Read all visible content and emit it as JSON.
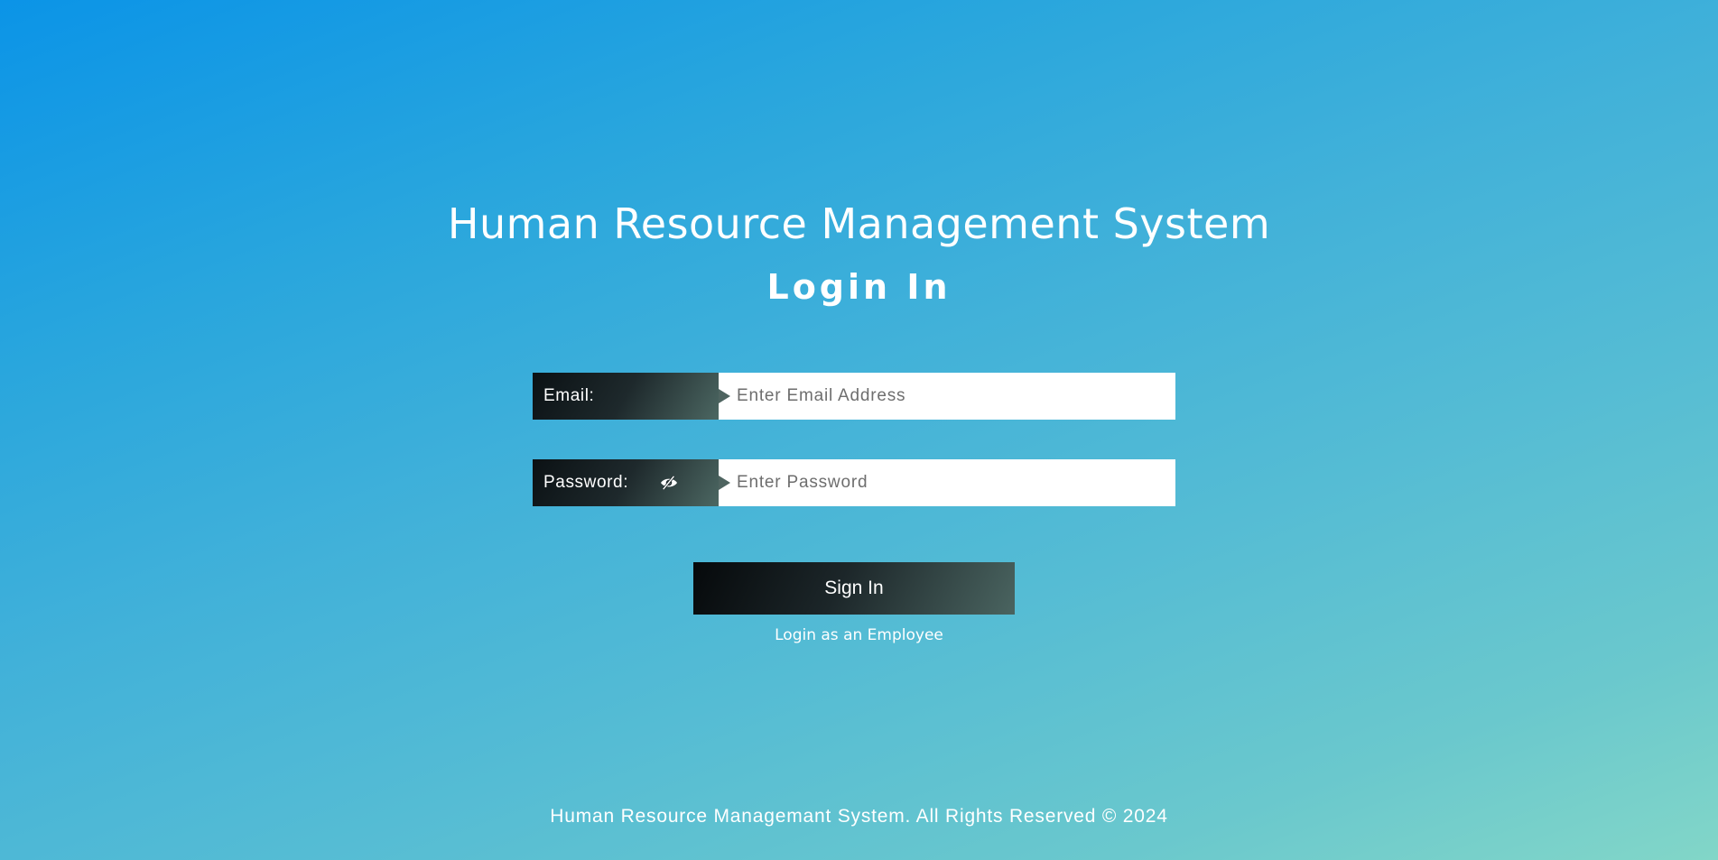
{
  "header": {
    "app_title": "Human Resource Management System",
    "login_heading": "Login In"
  },
  "form": {
    "email": {
      "label": "Email:",
      "placeholder": "Enter Email Address",
      "value": ""
    },
    "password": {
      "label": "Password:",
      "placeholder": "Enter Password",
      "value": "",
      "toggle_icon": "eye-slash-icon"
    },
    "submit_label": "Sign In",
    "alt_login_link": "Login as an Employee"
  },
  "footer": {
    "text": "Human Resource Managemant System. All Rights Reserved © 2024"
  },
  "colors": {
    "background_start": "#0b94e7",
    "background_end": "#82d6c8",
    "label_dark": "#0b1114",
    "label_accent": "#4c6762",
    "text": "#ffffff"
  }
}
